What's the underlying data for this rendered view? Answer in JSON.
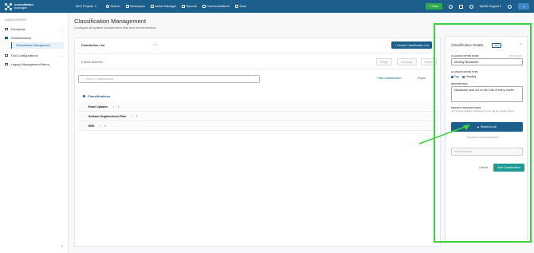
{
  "app": {
    "logo_line1": "consultation",
    "logo_line2": "manager",
    "project": "MCC Projects"
  },
  "topnav": {
    "items": [
      {
        "label": "Search",
        "icon": "search-icon"
      },
      {
        "label": "Workspace",
        "icon": "workspace-icon"
      },
      {
        "label": "Action Manager",
        "icon": "action-manager-icon"
      },
      {
        "label": "Reports",
        "icon": "reports-icon"
      },
      {
        "label": "Communications",
        "icon": "communications-icon"
      },
      {
        "label": "Tools",
        "icon": "tools-icon"
      }
    ],
    "new_label": "+ New",
    "user": "MySite Support",
    "help_label": "?"
  },
  "sidebar": {
    "title": "MANAGEMENT",
    "items": [
      {
        "label": "Enterprise",
        "icon": "building-icon"
      },
      {
        "label": "Classifications",
        "icon": "tag-icon"
      },
      {
        "label": "Tool Configurations",
        "icon": "wrench-icon"
      },
      {
        "label": "Legacy Management Menu",
        "icon": "list-icon"
      }
    ],
    "sub_item": "Classification Management",
    "collapse": "«"
  },
  "main": {
    "title": "Classification Management",
    "subtitle": "Configure all system classification lists and list hierarchies",
    "distribution_label": "Distribution List",
    "distribution_value": "— ▾",
    "create_button": "+ Create Classification List",
    "items_selected": "0 items Selected",
    "actions": [
      "Merge",
      "Reassign",
      "Delete"
    ],
    "search_placeholder": "Search Classifications",
    "add_classification": "+ Add Classification",
    "export": "Export",
    "group_header": "Classifications",
    "rows": [
      {
        "name": "Email Updates",
        "count": "4"
      },
      {
        "name": "Gotham Neighborhood Plan",
        "count": "2"
      },
      {
        "name": "SMS",
        "count": "3"
      }
    ]
  },
  "panel": {
    "title": "Classification Details",
    "badge": "NEW",
    "close": "×",
    "name_label": "CLASSIFICATION NAME",
    "required": "REQUIRED",
    "name_value": "Monthly Newsletter",
    "type_label": "CLASSIFICATION TYPE",
    "type_options": [
      "Tag",
      "Heading"
    ],
    "desc_label": "DESCRIPTION",
    "desc_value": "Newsletter sent out on the 14th of every month.",
    "restrictions_label": "PROJECT RESTRICTIONS",
    "restrictions_help": "Any Project visibility restriction for this tag are shown below.",
    "shared_button": "Shared to All",
    "restrict_link": "Restrict to selected Projects",
    "select_placeholder": "Select Projects",
    "cancel": "Cancel",
    "add_button": "Add Classification"
  },
  "colors": {
    "brand": "#1c5f8c",
    "annotation": "#3dd13d",
    "add": "#1c9a94"
  }
}
